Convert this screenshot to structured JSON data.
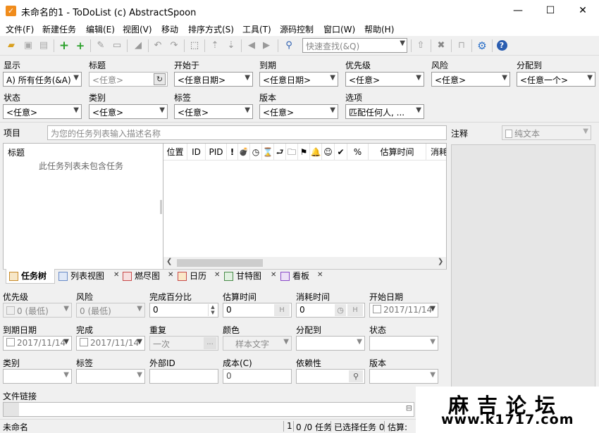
{
  "window": {
    "title": "未命名的1 - ToDoList (c) AbstractSpoon",
    "icon": "check-icon",
    "minimize": "—",
    "maximize": "☐",
    "close": "✕"
  },
  "menu": [
    "文件(F)",
    "新建任务",
    "编辑(E)",
    "视图(V)",
    "移动",
    "排序方式(S)",
    "工具(T)",
    "源码控制",
    "窗口(W)",
    "帮助(H)"
  ],
  "toolbar": {
    "quick_find_placeholder": "快速查找(&Q)",
    "icons": [
      "open-folder-icon",
      "save-icon",
      "save-all-icon",
      "new-task-icon",
      "new-subtask-icon",
      "edit-icon",
      "rename-icon",
      "clear-icon",
      "undo-icon",
      "redo-icon",
      "select-icon",
      "move-up-icon",
      "move-down-icon",
      "back-icon",
      "forward-icon",
      "find-icon",
      "sort-icon",
      "delete-icon",
      "lock-icon",
      "settings-icon",
      "help-icon"
    ]
  },
  "filters": {
    "show_label": "显示",
    "show_value": "A)  所有任务(&A)",
    "title_label": "标题",
    "title_placeholder": "<任意>",
    "start_label": "开始于",
    "start_value": "<任意日期>",
    "due_label": "到期",
    "due_value": "<任意日期>",
    "priority_label": "优先级",
    "priority_value": "<任意>",
    "risk_label": "风险",
    "risk_value": "<任意>",
    "assigned_label": "分配到",
    "assigned_value": "<任意一个>",
    "status_label": "状态",
    "status_value": "<任意>",
    "category_label": "类别",
    "category_value": "<任意>",
    "tag_label": "标签",
    "tag_value": "<任意>",
    "version_label": "版本",
    "version_value": "<任意>",
    "options_label": "选项",
    "options_value": "匹配任何人, ..."
  },
  "project": {
    "label": "项目",
    "placeholder": "为您的任务列表输入描述名称"
  },
  "notes": {
    "label": "注释",
    "format": "纯文本"
  },
  "tasklist": {
    "title_header": "标题",
    "empty_text": "此任务列表未包含任务",
    "columns": [
      "位置",
      "ID",
      "PID",
      "!",
      "💣",
      "◷",
      "⌛",
      "⮐",
      "🗀",
      "⚑",
      "🔔",
      "☺",
      "✔",
      "%",
      "估算时间",
      "消耗"
    ]
  },
  "tabs": [
    {
      "label": "任务树",
      "icon": "tree-icon"
    },
    {
      "label": "列表视图",
      "icon": "list-icon"
    },
    {
      "label": "燃尽图",
      "icon": "burndown-icon"
    },
    {
      "label": "日历",
      "icon": "calendar-icon"
    },
    {
      "label": "甘特图",
      "icon": "gantt-icon"
    },
    {
      "label": "看板",
      "icon": "kanban-icon"
    }
  ],
  "attributes": {
    "priority_label": "优先级",
    "priority_value": "0 (最低)",
    "risk_label": "风险",
    "risk_value": "0 (最低)",
    "percent_label": "完成百分比",
    "percent_value": "0",
    "estimate_label": "估算时间",
    "estimate_value": "0",
    "estimate_unit": "H",
    "spent_label": "消耗时间",
    "spent_value": "0",
    "spent_unit": "H",
    "startdate_label": "开始日期",
    "startdate_value": "2017/11/14",
    "duedate_label": "到期日期",
    "duedate_value": "2017/11/14",
    "done_label": "完成",
    "done_value": "2017/11/14",
    "recur_label": "重复",
    "recur_value": "一次",
    "recur_btn": "...",
    "color_label": "颜色",
    "color_value": "样本文字",
    "assigned_label": "分配到",
    "status_label": "状态",
    "category_label": "类别",
    "tag_label": "标签",
    "extid_label": "外部ID",
    "cost_label": "成本(C)",
    "cost_value": "0",
    "depend_label": "依赖性",
    "version_label": "版本",
    "filelink_label": "文件链接"
  },
  "status": {
    "filename": "未命名",
    "count1": "1",
    "count2": "0 /0 任务",
    "selected": "已选择任务 0",
    "estimate": "估算:"
  },
  "watermark": {
    "line1": "麻吉论坛",
    "line2": "www.k1717.com"
  }
}
